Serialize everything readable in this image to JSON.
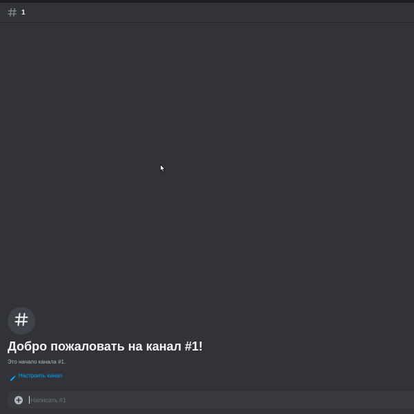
{
  "header": {
    "channel_name": "1",
    "icon": "hash-icon"
  },
  "welcome": {
    "icon": "hash-icon",
    "title": "Добро пожаловать на канал #1!",
    "subtitle": "Это начало канала #1.",
    "edit_label": "Настроить канал",
    "edit_icon": "pencil-icon"
  },
  "composer": {
    "placeholder": "Написать #1",
    "value": "",
    "add_icon": "plus-circle-icon"
  },
  "colors": {
    "background": "#313338",
    "header_border": "#27282c",
    "composer_bg": "#383a40",
    "link": "#00a8fc",
    "title": "#f2f3f5",
    "muted": "#b5bac1"
  }
}
